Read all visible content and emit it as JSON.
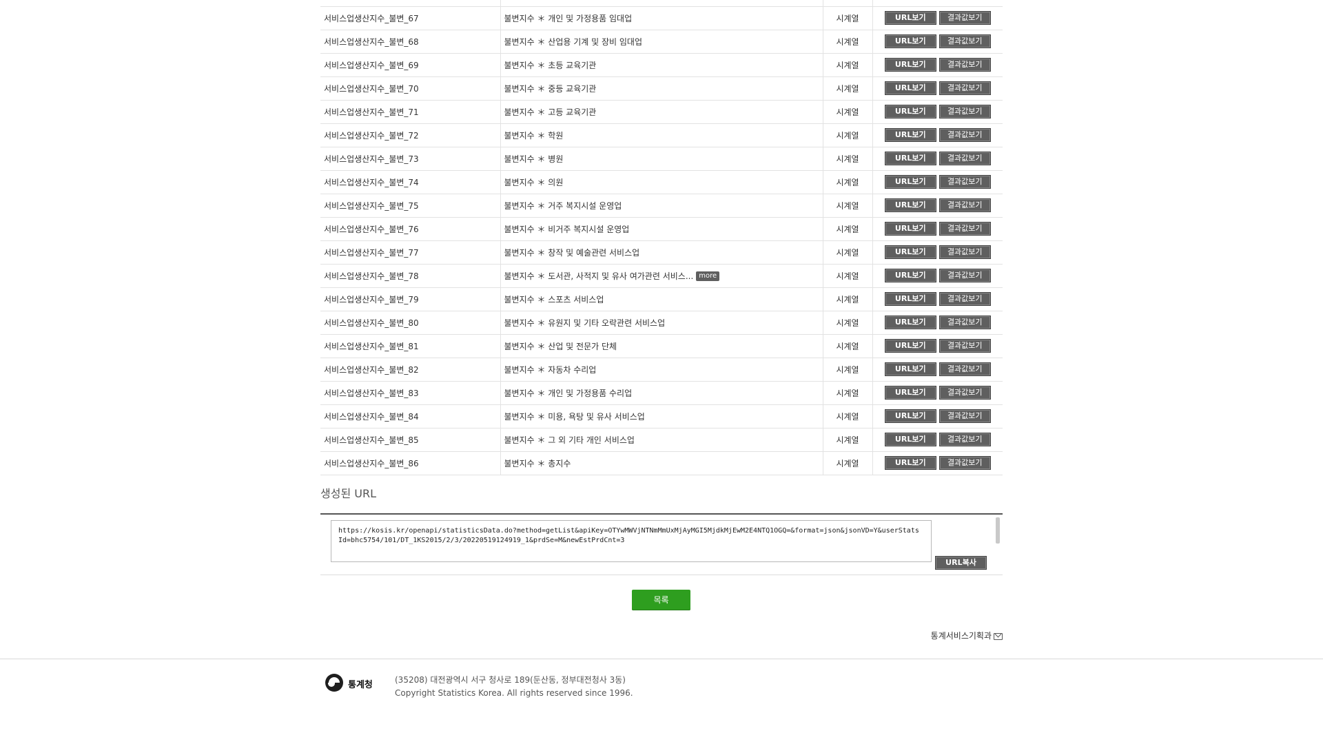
{
  "table": {
    "rows": [
      {
        "id": "서비스업생산지수_불변_67",
        "desc": "불변지수 ＊ 개인 및 가정용품 임대업",
        "type": "시계열",
        "more": false
      },
      {
        "id": "서비스업생산지수_불변_68",
        "desc": "불변지수 ＊ 산업용 기계 및 장비 임대업",
        "type": "시계열",
        "more": false
      },
      {
        "id": "서비스업생산지수_불변_69",
        "desc": "불변지수 ＊ 초등 교육기관",
        "type": "시계열",
        "more": false
      },
      {
        "id": "서비스업생산지수_불변_70",
        "desc": "불변지수 ＊ 중등 교육기관",
        "type": "시계열",
        "more": false
      },
      {
        "id": "서비스업생산지수_불변_71",
        "desc": "불변지수 ＊ 고등 교육기관",
        "type": "시계열",
        "more": false
      },
      {
        "id": "서비스업생산지수_불변_72",
        "desc": "불변지수 ＊ 학원",
        "type": "시계열",
        "more": false
      },
      {
        "id": "서비스업생산지수_불변_73",
        "desc": "불변지수 ＊ 병원",
        "type": "시계열",
        "more": false
      },
      {
        "id": "서비스업생산지수_불변_74",
        "desc": "불변지수 ＊ 의원",
        "type": "시계열",
        "more": false
      },
      {
        "id": "서비스업생산지수_불변_75",
        "desc": "불변지수 ＊ 거주 복지시설 운영업",
        "type": "시계열",
        "more": false
      },
      {
        "id": "서비스업생산지수_불변_76",
        "desc": "불변지수 ＊ 비거주 복지시설 운영업",
        "type": "시계열",
        "more": false
      },
      {
        "id": "서비스업생산지수_불변_77",
        "desc": "불변지수 ＊ 창작 및 예술관련 서비스업",
        "type": "시계열",
        "more": false
      },
      {
        "id": "서비스업생산지수_불변_78",
        "desc": "불변지수 ＊ 도서관, 사적지 및 유사 여가관련 서비스...",
        "type": "시계열",
        "more": true
      },
      {
        "id": "서비스업생산지수_불변_79",
        "desc": "불변지수 ＊ 스포츠 서비스업",
        "type": "시계열",
        "more": false
      },
      {
        "id": "서비스업생산지수_불변_80",
        "desc": "불변지수 ＊ 유원지 및 기타 오락관련 서비스업",
        "type": "시계열",
        "more": false
      },
      {
        "id": "서비스업생산지수_불변_81",
        "desc": "불변지수 ＊ 산업 및 전문가 단체",
        "type": "시계열",
        "more": false
      },
      {
        "id": "서비스업생산지수_불변_82",
        "desc": "불변지수 ＊ 자동차 수리업",
        "type": "시계열",
        "more": false
      },
      {
        "id": "서비스업생산지수_불변_83",
        "desc": "불변지수 ＊ 개인 및 가정용품 수리업",
        "type": "시계열",
        "more": false
      },
      {
        "id": "서비스업생산지수_불변_84",
        "desc": "불변지수 ＊ 미용, 욕탕 및 유사 서비스업",
        "type": "시계열",
        "more": false
      },
      {
        "id": "서비스업생산지수_불변_85",
        "desc": "불변지수 ＊ 그 외 기타 개인 서비스업",
        "type": "시계열",
        "more": false
      },
      {
        "id": "서비스업생산지수_불변_86",
        "desc": "불변지수 ＊ 총지수",
        "type": "시계열",
        "more": false
      }
    ],
    "url_button_label": "URL보기",
    "result_button_label": "결과값보기",
    "more_label": "more"
  },
  "url_section": {
    "title": "생성된 URL",
    "url": "https://kosis.kr/openapi/statisticsData.do?method=getList&apiKey=OTYwMWVjNTNmMmUxMjAyMGI5MjdkMjEwM2E4NTQ1OGQ=&format=json&jsonVD=Y&userStatsId=bhc5754/101/DT_1KS2015/2/3/20220519124919_1&prdSe=M&newEstPrdCnt=3",
    "copy_button_label": "URL복사"
  },
  "list_button_label": "목록",
  "contact_label": "통계서비스기획과",
  "footer": {
    "logo_text": "통계청",
    "address": "(35208) 대전광역시 서구 청사로 189(둔산동, 정부대전청사 3동)",
    "copyright": "Copyright Statistics Korea. All rights reserved since 1996."
  }
}
